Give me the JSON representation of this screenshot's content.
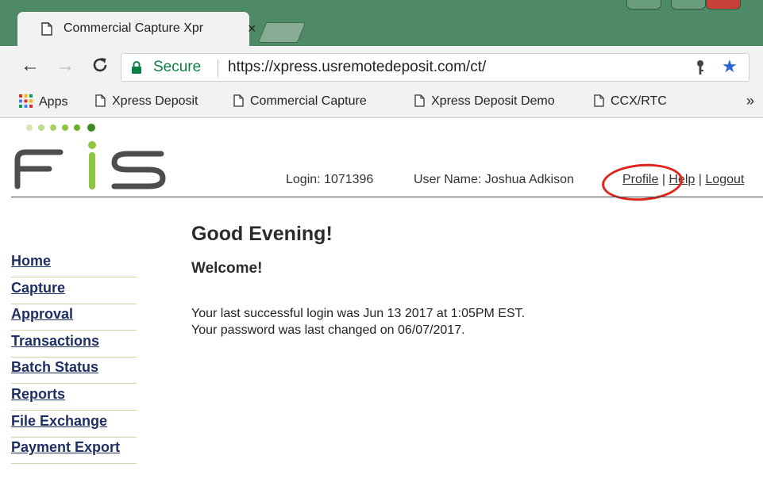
{
  "browser": {
    "tab_title": "Commercial Capture Xpr",
    "tab_close": "×",
    "secure_label": "Secure",
    "url": "https://xpress.usremotedeposit.com/ct/",
    "bookmarks": [
      {
        "label": "Apps"
      },
      {
        "label": "Xpress Deposit"
      },
      {
        "label": "Commercial Capture"
      },
      {
        "label": "Xpress Deposit Demo"
      },
      {
        "label": "CCX/RTC"
      }
    ],
    "bookmarks_more": "»"
  },
  "header": {
    "logo_text": "FIS",
    "login": "Login: 1071396",
    "username": "User Name: Joshua Adkison",
    "links": {
      "profile": "Profile",
      "help": "Help",
      "logout": "Logout",
      "separator": "|"
    }
  },
  "sidebar": {
    "items": [
      {
        "label": "Home"
      },
      {
        "label": "Capture"
      },
      {
        "label": "Approval"
      },
      {
        "label": "Transactions"
      },
      {
        "label": "Batch Status"
      },
      {
        "label": "Reports"
      },
      {
        "label": "File Exchange"
      },
      {
        "label": "Payment Export"
      }
    ]
  },
  "main": {
    "greeting": "Good Evening!",
    "welcome": "Welcome!",
    "last_login": "Your last successful login was Jun 13 2017 at 1:05PM EST.",
    "password_changed": "Your password was last changed on 06/07/2017."
  },
  "colors": {
    "titlebar": "#4f8a66",
    "secure_green": "#0b8043",
    "nav_link": "#1d2f63",
    "logo_green": "#8dc63f",
    "logo_gray": "#4d4d4d",
    "highlight": "#e0231c"
  }
}
